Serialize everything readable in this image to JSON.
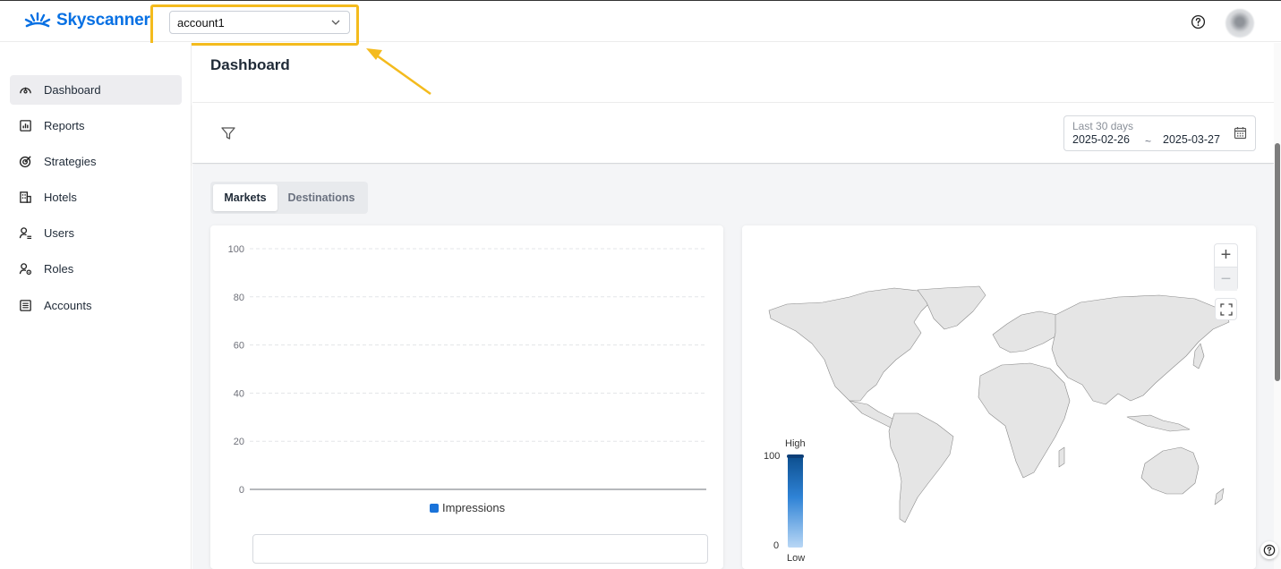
{
  "header": {
    "logo_text": "Skyscanner",
    "brand_color": "#0770e3",
    "account_selector": {
      "value": "account1",
      "icon": "chevron-down-icon"
    },
    "highlight_color": "#f4bb1d",
    "help_icon": "help-circle-icon",
    "avatar": "user-avatar"
  },
  "sidebar": {
    "items": [
      {
        "label": "Dashboard",
        "icon": "dashboard-icon",
        "active": true
      },
      {
        "label": "Reports",
        "icon": "bar-chart-icon"
      },
      {
        "label": "Strategies",
        "icon": "target-icon"
      },
      {
        "label": "Hotels",
        "icon": "building-icon"
      },
      {
        "label": "Users",
        "icon": "user-list-icon"
      },
      {
        "label": "Roles",
        "icon": "user-gear-icon"
      },
      {
        "label": "Accounts",
        "icon": "list-icon"
      }
    ]
  },
  "main": {
    "title": "Dashboard",
    "filter_icon": "filter-icon",
    "date_range": {
      "label": "Last 30 days",
      "start": "2025-02-26",
      "separator": "~",
      "end": "2025-03-27",
      "icon": "calendar-icon"
    },
    "tabs": [
      {
        "label": "Markets",
        "active": true
      },
      {
        "label": "Destinations",
        "active": false
      }
    ]
  },
  "chart_data": {
    "type": "bar",
    "categories": [],
    "series": [
      {
        "name": "Impressions",
        "values": [],
        "color": "#1a73d9"
      }
    ],
    "y_ticks": [
      "100",
      "80",
      "60",
      "40",
      "20",
      "0"
    ],
    "ylim": [
      0,
      100
    ],
    "grid": true,
    "legend": "bottom"
  },
  "map": {
    "zoom_in_label": "+",
    "zoom_out_label": "−",
    "fullscreen_icon": "fullscreen-icon",
    "legend_high_label": "High",
    "legend_low_label": "Low",
    "legend_max": "100",
    "legend_min": "0",
    "fill_color": "#e5e5e5"
  }
}
